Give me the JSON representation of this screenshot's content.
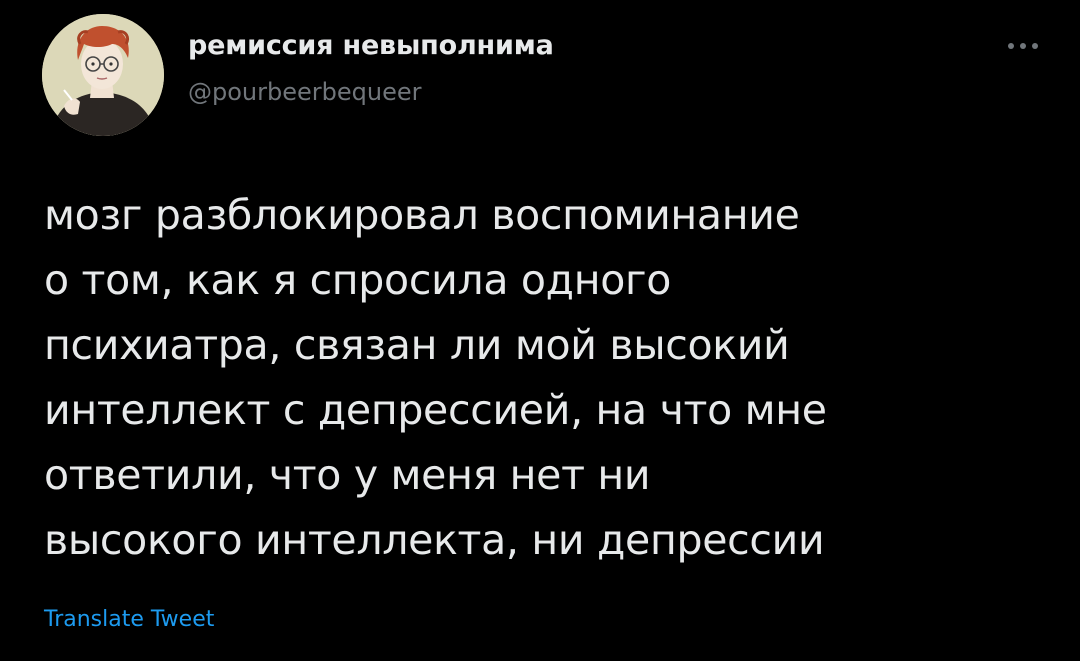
{
  "tweet": {
    "author": {
      "display_name": "ремиссия невыполнима",
      "handle": "@pourbeerbequeer",
      "avatar_icon": "illustrated-avatar-icon"
    },
    "more_icon": "more-options-icon",
    "text_lines": [
      "мозг разблокировал воспоминание",
      "о том, как я спросила одного",
      "психиатра, связан ли мой высокий",
      "интеллект с депрессией, на что мне",
      "ответили, что у меня нет ни",
      "высокого интеллекта, ни депрессии"
    ],
    "translate_label": "Translate Tweet"
  },
  "colors": {
    "background": "#000000",
    "primary_text": "#e7e9ea",
    "secondary_text": "#71767b",
    "link": "#1d9bf0"
  }
}
